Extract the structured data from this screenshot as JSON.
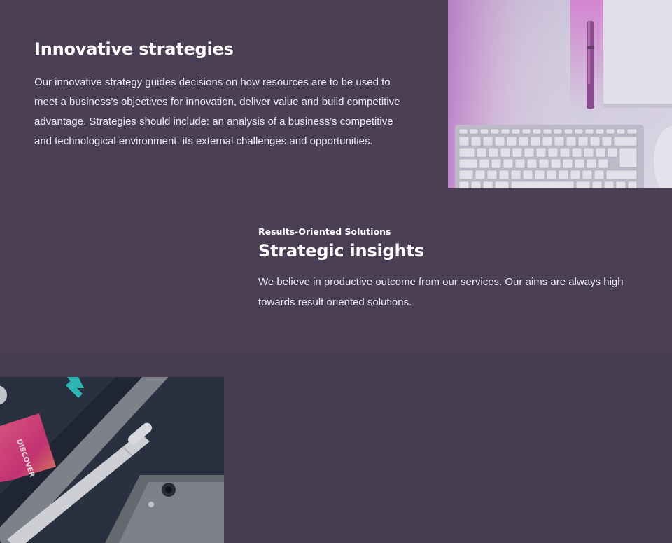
{
  "section_one": {
    "heading": "Innovative strategies",
    "body": "Our innovative strategy guides decisions on how resources are to be used to meet a business’s objectives for innovation, deliver value and build competitive advantage. Strategies should include: an analysis of a business’s competitive and technological environment. its external challenges and opportunities."
  },
  "section_two": {
    "eyebrow": "Results-Oriented Solutions",
    "heading": "Strategic insights",
    "body": "We believe in productive outcome from our services. Our aims are always high towards result oriented solutions."
  },
  "images": {
    "keyboard_photo": "keyboard-pen-photo",
    "tablet_photo": "tablet-pencil-phone-photo"
  },
  "colors": {
    "background": "#4a3f55",
    "heading_text": "#ffffff",
    "body_text": "#f1edf4",
    "accent_pink": "#d14ba6"
  }
}
